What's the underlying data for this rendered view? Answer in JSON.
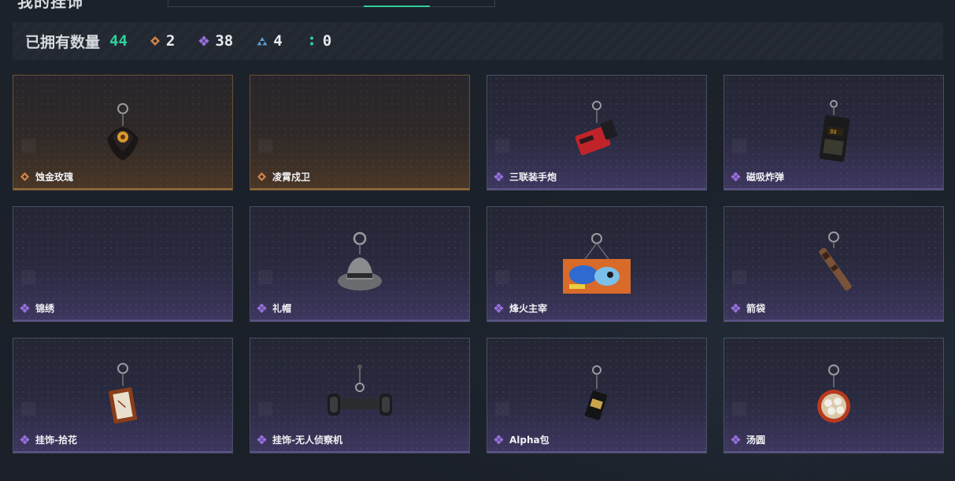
{
  "header": {
    "title": "我的挂饰"
  },
  "stats": {
    "label": "已拥有数量",
    "total": "44",
    "rarities": [
      {
        "icon": "gold-diamond-icon",
        "color": "#d0834a",
        "count": "2"
      },
      {
        "icon": "purple-diamond-icon",
        "color": "#9a72e0",
        "count": "38"
      },
      {
        "icon": "blue-triangle-icon",
        "color": "#5a9ad6",
        "count": "4"
      },
      {
        "icon": "green-dots-icon",
        "color": "#2fd19b",
        "count": "0"
      }
    ]
  },
  "items": [
    {
      "name": "蚀金玫瑰",
      "rarity": "gold",
      "art": "rose"
    },
    {
      "name": "凌霄戍卫",
      "rarity": "gold",
      "art": "none"
    },
    {
      "name": "三联装手炮",
      "rarity": "purple",
      "art": "cannon"
    },
    {
      "name": "磁吸炸弹",
      "rarity": "purple",
      "art": "bomb"
    },
    {
      "name": "锦绣",
      "rarity": "purple",
      "art": "none"
    },
    {
      "name": "礼帽",
      "rarity": "purple",
      "art": "hat"
    },
    {
      "name": "烽火主宰",
      "rarity": "purple",
      "art": "container"
    },
    {
      "name": "箭袋",
      "rarity": "purple",
      "art": "quiver"
    },
    {
      "name": "挂饰-拾花",
      "rarity": "purple",
      "art": "frame"
    },
    {
      "name": "挂饰-无人侦察机",
      "rarity": "purple",
      "art": "drone"
    },
    {
      "name": "Alpha包",
      "rarity": "purple",
      "art": "pouch"
    },
    {
      "name": "汤圆",
      "rarity": "purple",
      "art": "bowl"
    }
  ]
}
